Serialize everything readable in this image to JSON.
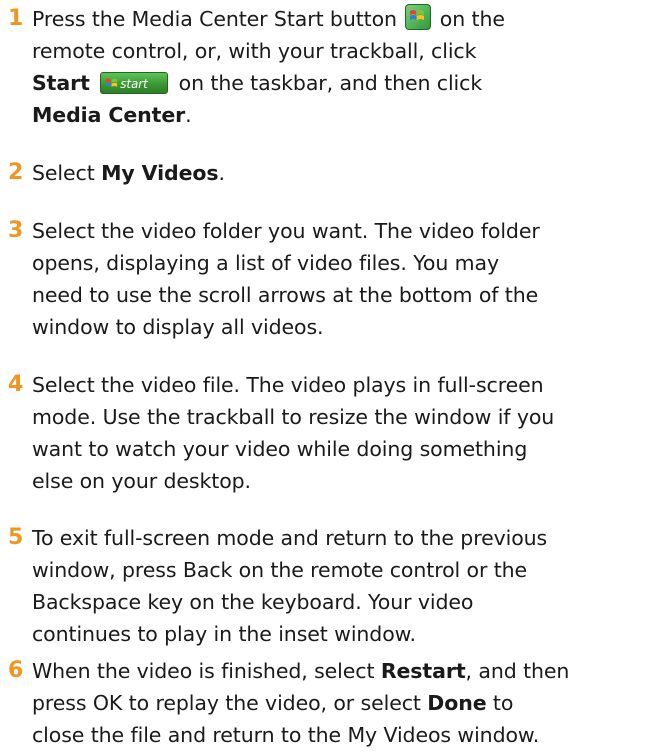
{
  "accent_color": "#f0961e",
  "icons": {
    "media_center_start": "windows-flag-icon",
    "start_button": "windows-flag-icon"
  },
  "steps": [
    {
      "number": "1",
      "line1a": "Press the Media Center Start button",
      "line1b": "on the",
      "line2": "remote control, or, with your trackball, click",
      "line3_bold": "Start",
      "start_button_label": "start",
      "line3b": "on the taskbar, and then click",
      "line4_bold": "Media Center",
      "line4_end": "."
    },
    {
      "number": "2",
      "pre": "Select",
      "bold": "My Videos",
      "post": "."
    },
    {
      "number": "3",
      "lines": [
        "Select the video folder you want. The video folder",
        "opens, displaying a list of video files. You may",
        "need to use the scroll arrows at the bottom of the",
        "window to display all videos."
      ]
    },
    {
      "number": "4",
      "lines": [
        "Select the video file. The video plays in full-screen",
        "mode. Use the trackball to resize the window if you",
        "want to watch your video while doing something",
        "else on your desktop."
      ]
    },
    {
      "number": "5",
      "lines": [
        "To exit full-screen mode and return to the previous",
        "window, press Back on the remote control or the",
        "Backspace key on the keyboard. Your video",
        "continues to play in the inset window."
      ]
    },
    {
      "number": "6",
      "line1a": "When the video is finished, select",
      "line1_bold": "Restart",
      "line1b": ", and then",
      "line2a": "press OK to replay the video, or select",
      "line2_bold": "Done",
      "line2b": "to",
      "line3": "close the file and return to the My Videos window."
    }
  ]
}
